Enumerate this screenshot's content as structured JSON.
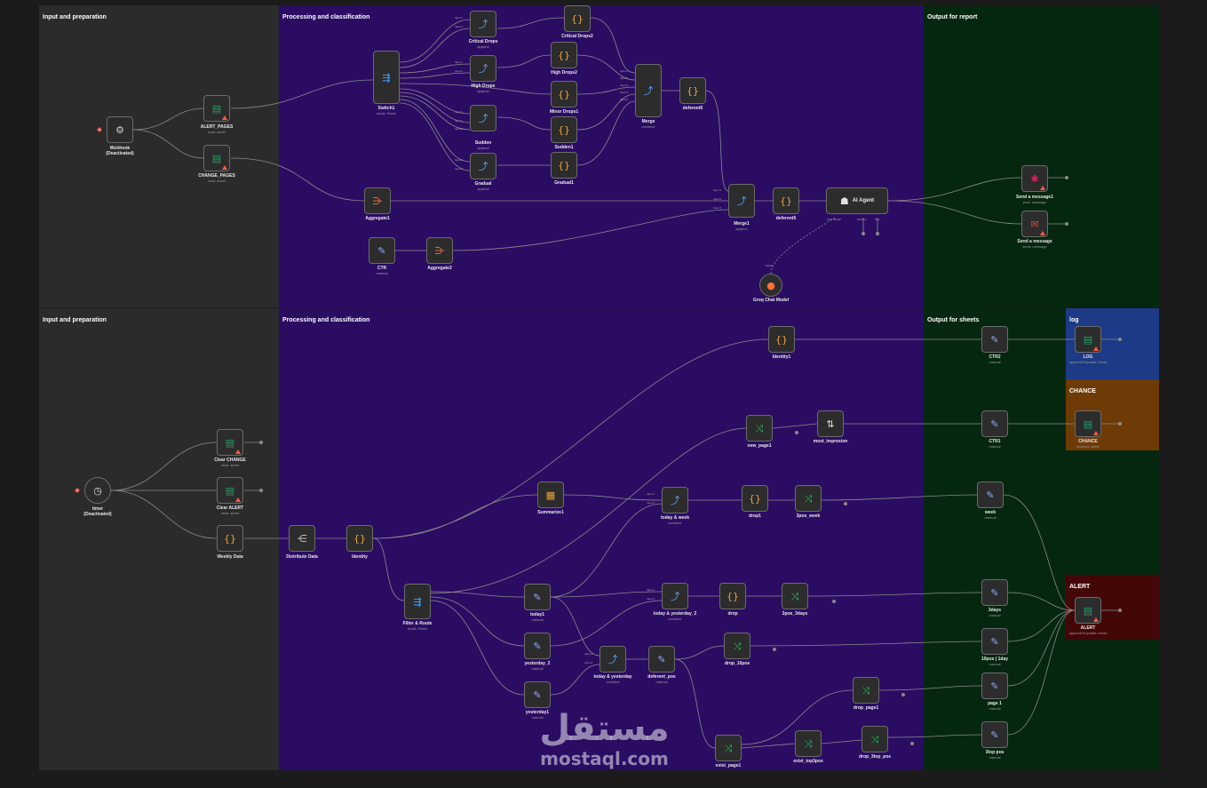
{
  "colors": {
    "canvas": "#1b1b1b",
    "input_bg": "#2b2b2b",
    "processing_bg": "#2b0c63",
    "output_bg": "#06270f",
    "log_bg": "#1c3a85",
    "chance_bg": "#6e3a05",
    "alert_bg": "#430707",
    "edge": "#8a8a8a",
    "sheets_green": "#1fa463",
    "code_orange": "#f0a23c",
    "switch_blue": "#41a0ff",
    "merge_blue": "#5aa2ff",
    "filter_green": "#24c15a",
    "aggregate_orange": "#ff6d3a",
    "edit_blue": "#8da8ff",
    "trigger": "#ff6d5a"
  },
  "sticky_notes": [
    {
      "id": "s_in_top",
      "title": "Input and preparation"
    },
    {
      "id": "s_proc_top",
      "title": "Processing and classification"
    },
    {
      "id": "s_out_top",
      "title": "Output for report"
    },
    {
      "id": "s_in_bot",
      "title": "Input and preparation"
    },
    {
      "id": "s_proc_bot",
      "title": "Processing and classification"
    },
    {
      "id": "s_out_bot",
      "title": "Output for sheets"
    },
    {
      "id": "s_log",
      "title": "log"
    },
    {
      "id": "s_chance",
      "title": "CHANCE"
    },
    {
      "id": "s_alert",
      "title": "ALERT"
    }
  ],
  "nodes": {
    "webhook": {
      "label": "Webhook",
      "sub": "(Deactivated)",
      "icon": "webhook-icon"
    },
    "alert_pages": {
      "label": "ALERT_PAGES",
      "sub": "read: sheet",
      "icon": "google-sheets-icon"
    },
    "change_pages": {
      "label": "CHANGE_PAGES",
      "sub": "read: sheet",
      "icon": "google-sheets-icon"
    },
    "switch1": {
      "label": "Switch1",
      "sub": "mode: Rules",
      "icon": "switch-icon"
    },
    "critical_drops": {
      "label": "Critical Drops",
      "sub": "append",
      "icon": "merge-icon"
    },
    "high_drops": {
      "label": "High Drops",
      "sub": "append",
      "icon": "merge-icon"
    },
    "sudden": {
      "label": "Sudden",
      "sub": "append",
      "icon": "merge-icon"
    },
    "gradual": {
      "label": "Gradual",
      "sub": "append",
      "icon": "merge-icon"
    },
    "critical_drops2": {
      "label": "Critical Drops2",
      "sub": "",
      "icon": "code-icon"
    },
    "high_drops2": {
      "label": "High Drops2",
      "sub": "",
      "icon": "code-icon"
    },
    "minor_drops1": {
      "label": "Minor Drops1",
      "sub": "",
      "icon": "code-icon"
    },
    "sudden1": {
      "label": "Sudden1",
      "sub": "",
      "icon": "code-icon"
    },
    "gradual1": {
      "label": "Gradual1",
      "sub": "",
      "icon": "code-icon"
    },
    "merge": {
      "label": "Merge",
      "sub": "combine",
      "icon": "merge-icon"
    },
    "deferent6": {
      "label": "deferent6",
      "sub": "",
      "icon": "code-icon"
    },
    "aggregate1": {
      "label": "Aggregate1",
      "sub": "",
      "icon": "aggregate-icon"
    },
    "merge1": {
      "label": "Merge1",
      "sub": "append",
      "icon": "merge-icon"
    },
    "deferent5": {
      "label": "deferent5",
      "sub": "",
      "icon": "code-icon"
    },
    "ai_agent": {
      "label": "AI Agent",
      "sub": "",
      "icon": "robot-icon"
    },
    "ctr": {
      "label": "CTR",
      "sub": "manual",
      "icon": "edit-icon"
    },
    "aggregate2": {
      "label": "Aggregate2",
      "sub": "",
      "icon": "aggregate-icon"
    },
    "groq": {
      "label": "Groq Chat Model",
      "sub": "",
      "icon": "groq-icon"
    },
    "slack": {
      "label": "Send a message1",
      "sub": "post: message",
      "icon": "slack-icon"
    },
    "gmail": {
      "label": "Send a message",
      "sub": "send: message",
      "icon": "gmail-icon"
    },
    "timer": {
      "label": "timer",
      "sub": "(Deactivated)",
      "icon": "clock-icon"
    },
    "clear_change": {
      "label": "Clear CHANGE",
      "sub": "clear: sheet",
      "icon": "google-sheets-icon"
    },
    "clear_alert": {
      "label": "Clear ALERT",
      "sub": "clear: sheet",
      "icon": "google-sheets-icon"
    },
    "weekly_data": {
      "label": "Weekly Data",
      "sub": "",
      "icon": "code-icon"
    },
    "distribute": {
      "label": "Distribute Data",
      "sub": "",
      "icon": "split-icon"
    },
    "identity": {
      "label": "Identity",
      "sub": "",
      "icon": "code-icon"
    },
    "identity1": {
      "label": "Identity1",
      "sub": "",
      "icon": "code-icon"
    },
    "summarize1": {
      "label": "Summarize1",
      "sub": "",
      "icon": "summarize-icon"
    },
    "filter_route": {
      "label": "Filter & Route",
      "sub": "mode: Rules",
      "icon": "switch-icon"
    },
    "today1": {
      "label": "today1",
      "sub": "manual",
      "icon": "edit-icon"
    },
    "yesterday2": {
      "label": "yesterday_2",
      "sub": "manual",
      "icon": "edit-icon"
    },
    "yesterday1": {
      "label": "yesterday1",
      "sub": "manual",
      "icon": "edit-icon"
    },
    "today_week": {
      "label": "today & week",
      "sub": "combine",
      "icon": "merge-icon"
    },
    "today_yesterday2": {
      "label": "today & yesterday_2",
      "sub": "combine",
      "icon": "merge-icon"
    },
    "today_yesterday": {
      "label": "today & yesterday",
      "sub": "combine",
      "icon": "merge-icon"
    },
    "deferent_pos": {
      "label": "deferent_pos",
      "sub": "manual",
      "icon": "edit-icon"
    },
    "drop1": {
      "label": "drop1",
      "sub": "",
      "icon": "code-icon"
    },
    "drop": {
      "label": "drop",
      "sub": "",
      "icon": "code-icon"
    },
    "three_pos_week": {
      "label": "3pos_week",
      "sub": "",
      "icon": "filter-icon"
    },
    "three_pos_3days": {
      "label": "3pos_3days",
      "sub": "",
      "icon": "filter-icon"
    },
    "drop_10pos": {
      "label": "drop_10pos",
      "sub": "",
      "icon": "filter-icon"
    },
    "drop_page1": {
      "label": "drop_page1",
      "sub": "",
      "icon": "filter-icon"
    },
    "exist_page1": {
      "label": "exist_page1",
      "sub": "",
      "icon": "filter-icon"
    },
    "exist_top3pos": {
      "label": "exist_top3pos",
      "sub": "",
      "icon": "filter-icon"
    },
    "drop_3top_pos": {
      "label": "drop_3top_pos",
      "sub": "",
      "icon": "filter-icon"
    },
    "new_page1": {
      "label": "new_page1",
      "sub": "",
      "icon": "filter-icon"
    },
    "most_impression": {
      "label": "most_impresion",
      "sub": "",
      "icon": "sort-icon"
    },
    "ctr2": {
      "label": "CTR2",
      "sub": "manual",
      "icon": "edit-icon"
    },
    "ctr1": {
      "label": "CTR1",
      "sub": "manual",
      "icon": "edit-icon"
    },
    "week": {
      "label": "week",
      "sub": "manual",
      "icon": "edit-icon"
    },
    "three_days": {
      "label": "3days",
      "sub": "manual",
      "icon": "edit-icon"
    },
    "ten_pos_1day": {
      "label": "10pos | 1day",
      "sub": "manual",
      "icon": "edit-icon"
    },
    "page1": {
      "label": "page 1",
      "sub": "manual",
      "icon": "edit-icon"
    },
    "three_top_pos": {
      "label": "3top pos",
      "sub": "manual",
      "icon": "edit-icon"
    },
    "log": {
      "label": "LOG",
      "sub": "appendOrUpdate: sheet",
      "icon": "google-sheets-icon"
    },
    "chance": {
      "label": "CHANCE",
      "sub": "append: sheet",
      "icon": "google-sheets-icon"
    },
    "alert": {
      "label": "ALERT",
      "sub": "appendOrUpdate: sheet",
      "icon": "google-sheets-icon"
    }
  },
  "port_labels": {
    "input1": "Input 1",
    "input2": "Input 2",
    "input3": "Input 3",
    "input4": "Input 4",
    "input5": "Input 5",
    "chat_model": "Chat Model*",
    "memory": "Memory",
    "tool": "Tool",
    "model": "Model"
  },
  "watermark": {
    "arabic": "مستقل",
    "latin": "mostaql.com"
  }
}
